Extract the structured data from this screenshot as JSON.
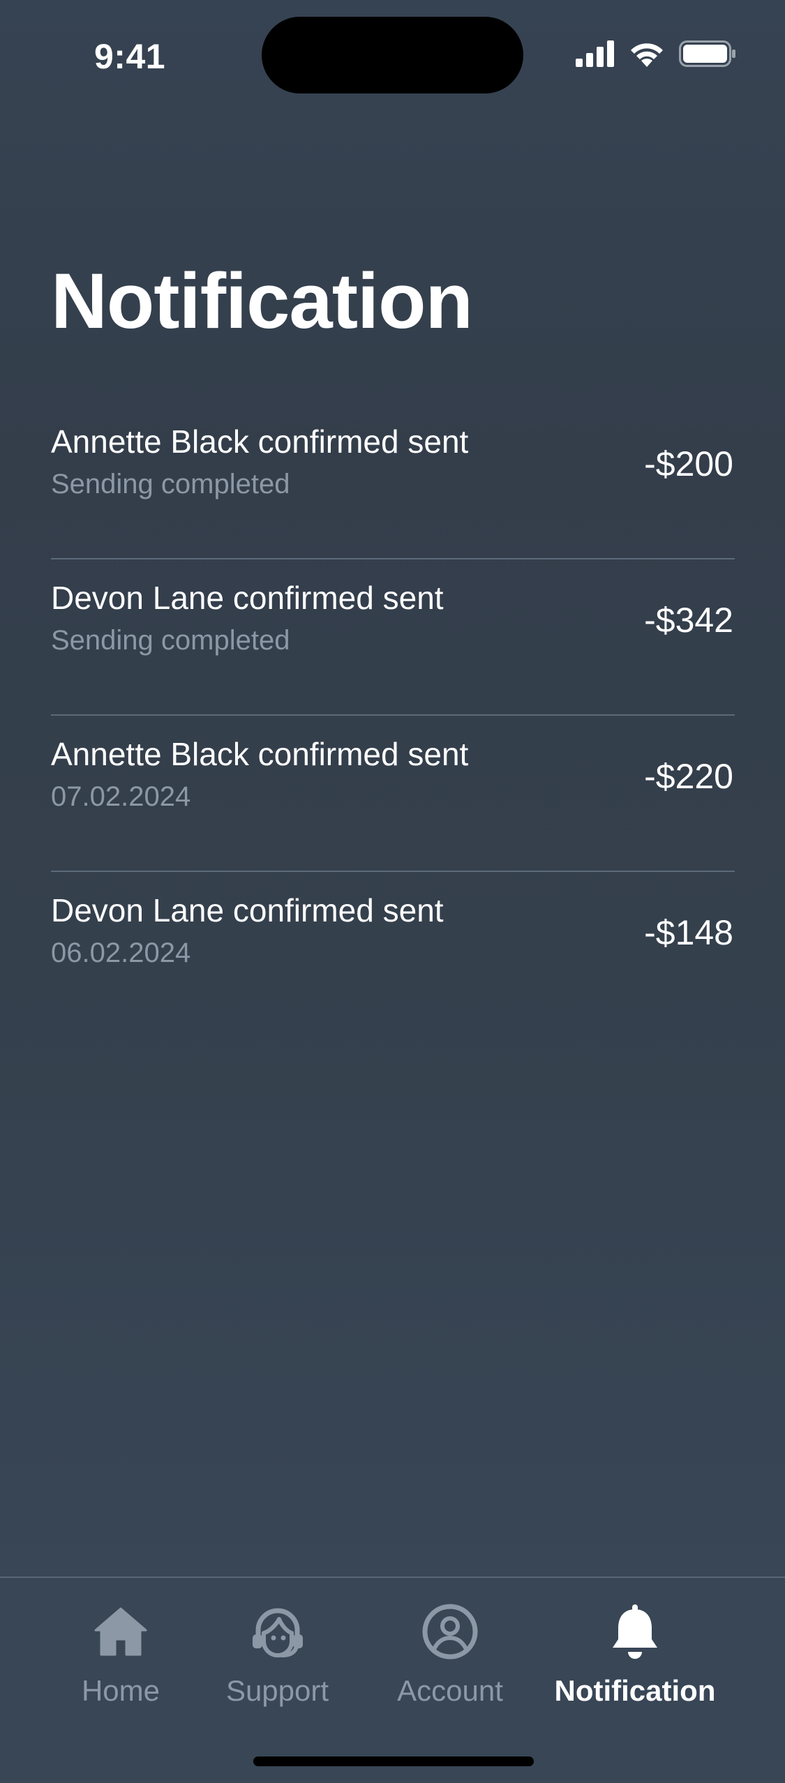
{
  "status_bar": {
    "time": "9:41"
  },
  "page": {
    "title": "Notification"
  },
  "notifications": [
    {
      "title": "Annette Black confirmed sent",
      "subtitle": "Sending completed",
      "amount": "-$200"
    },
    {
      "title": "Devon Lane confirmed sent",
      "subtitle": "Sending completed",
      "amount": "-$342"
    },
    {
      "title": "Annette Black confirmed sent",
      "subtitle": "07.02.2024",
      "amount": "-$220"
    },
    {
      "title": "Devon Lane confirmed sent",
      "subtitle": "06.02.2024",
      "amount": "-$148"
    }
  ],
  "tab_bar": {
    "tabs": [
      {
        "label": "Home",
        "icon": "home-icon"
      },
      {
        "label": "Support",
        "icon": "support-icon"
      },
      {
        "label": "Account",
        "icon": "account-icon"
      },
      {
        "label": "Notification",
        "icon": "bell-icon",
        "active": true
      }
    ]
  },
  "colors": {
    "background": "#364352",
    "divider": "#5d6a79",
    "muted_text": "#8c98a6",
    "active_text": "#ffffff"
  }
}
